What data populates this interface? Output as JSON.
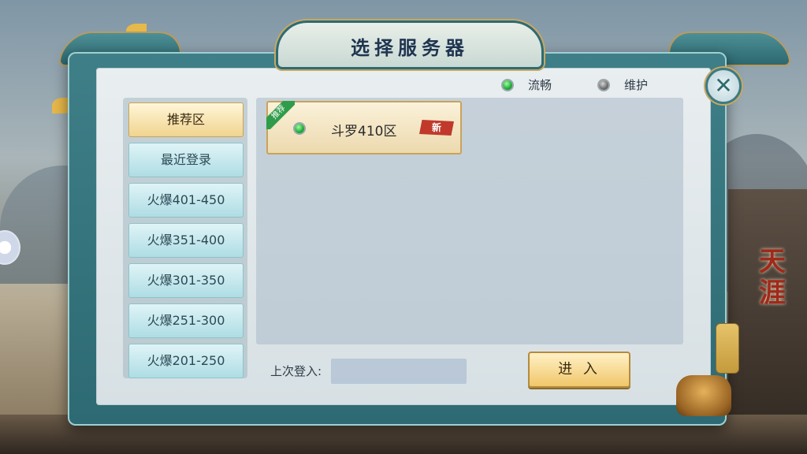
{
  "title": "选择服务器",
  "status_legend": [
    {
      "label": "流畅",
      "color": "#1faa3a"
    },
    {
      "label": "维护",
      "color": "#6e6e6e"
    }
  ],
  "tabs": [
    {
      "label": "推荐区",
      "active": true
    },
    {
      "label": "最近登录",
      "active": false
    },
    {
      "label": "火爆401-450",
      "active": false
    },
    {
      "label": "火爆351-400",
      "active": false
    },
    {
      "label": "火爆301-350",
      "active": false
    },
    {
      "label": "火爆251-300",
      "active": false
    },
    {
      "label": "火爆201-250",
      "active": false
    }
  ],
  "servers": [
    {
      "name": "斗罗410区",
      "status": "流畅",
      "ribbon": "推荐",
      "tag": "新"
    }
  ],
  "last_login": {
    "label": "上次登入:",
    "value": ""
  },
  "enter_button": "进 入",
  "side_title": "天涯",
  "icons": {
    "close": "close-icon",
    "scroll": "scroll-handle-icon",
    "incense": "incense-burner-icon"
  }
}
